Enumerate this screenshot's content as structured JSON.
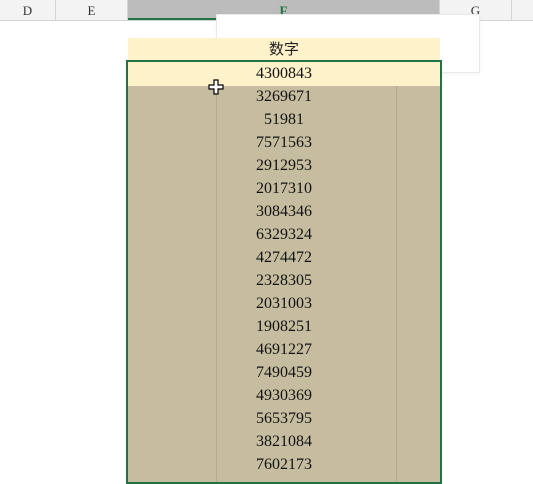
{
  "columns": {
    "d": "D",
    "e": "E",
    "f": "F",
    "g": "G"
  },
  "sheet": {
    "header": "数字",
    "values": [
      "4300843",
      "3269671",
      "51981",
      "7571563",
      "2912953",
      "2017310",
      "3084346",
      "6329324",
      "4274472",
      "2328305",
      "2031003",
      "1908251",
      "4691227",
      "7490459",
      "4930369",
      "5653795",
      "3821084",
      "7602173"
    ]
  },
  "colors": {
    "selection_border": "#217346",
    "selection_fill": "#c6bda0",
    "header_fill": "#fef2cb"
  },
  "icons": {
    "cursor": "plus-cross-cursor-icon"
  }
}
